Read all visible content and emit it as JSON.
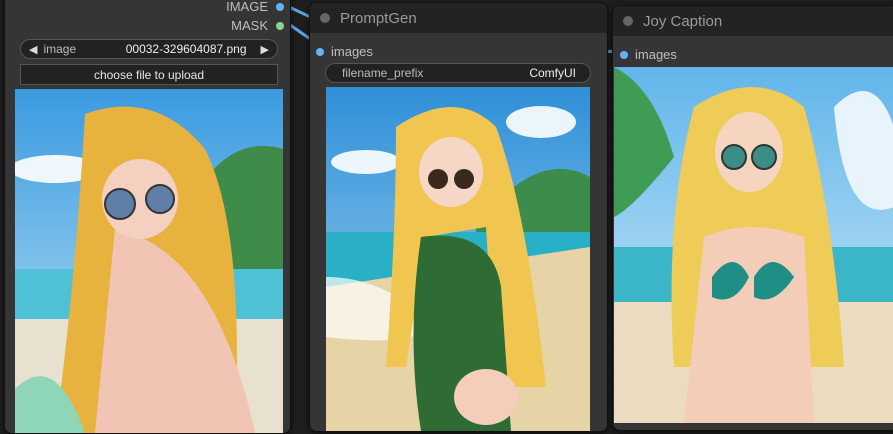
{
  "load_node": {
    "outputs": [
      "IMAGE",
      "MASK"
    ],
    "image_widget": {
      "label": "image",
      "value": "00032-329604087.png"
    },
    "upload_label": "choose file to upload"
  },
  "prompt_node": {
    "title": "PromptGen",
    "input": "images",
    "prefix_widget": {
      "label": "filename_prefix",
      "value": "ComfyUI"
    }
  },
  "caption_node": {
    "title": "Joy Caption",
    "input": "images"
  },
  "colors": {
    "accent_blue": "#64b5f6",
    "mask_green": "#8bd28b"
  }
}
